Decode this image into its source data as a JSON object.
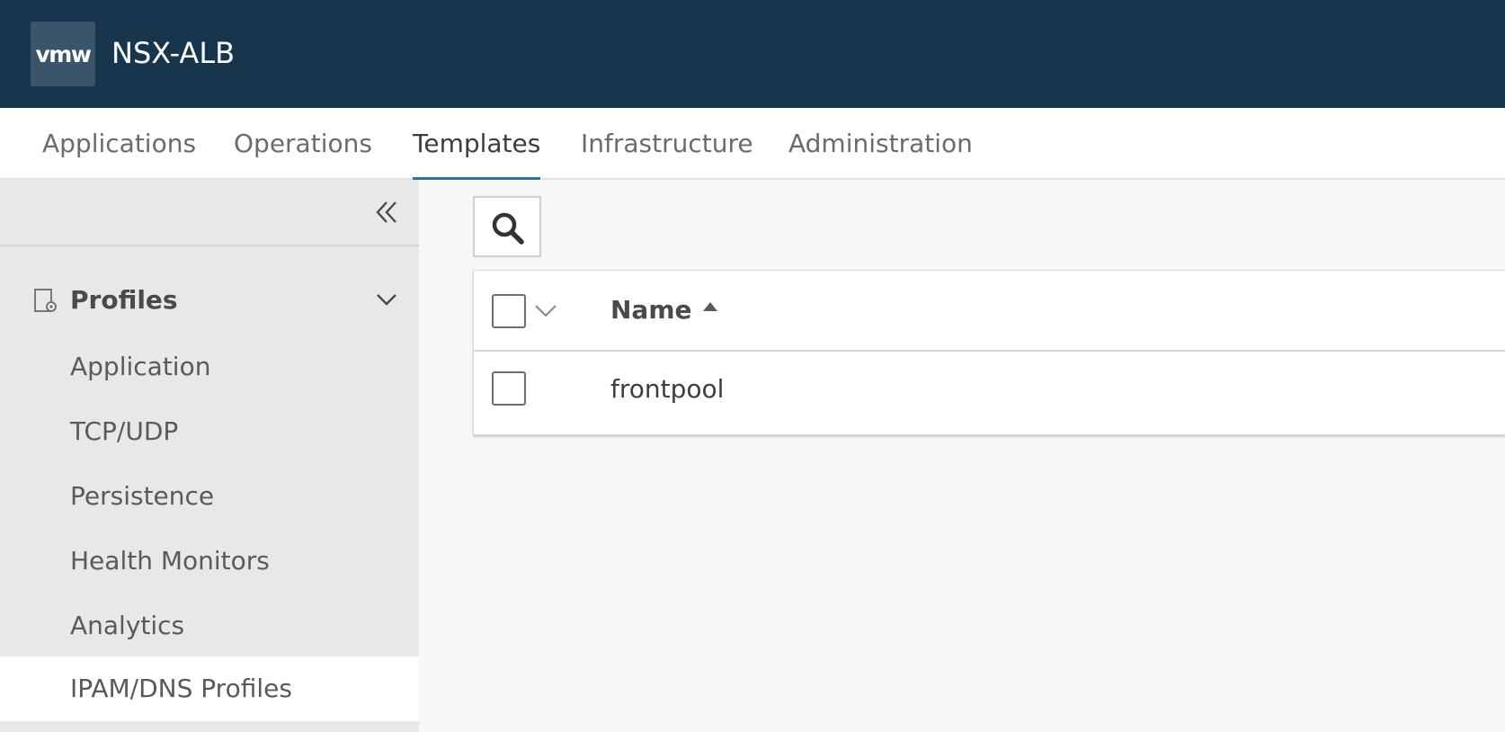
{
  "header": {
    "logo_text": "vmw",
    "app_title": "NSX-ALB"
  },
  "nav": {
    "tabs": [
      {
        "label": "Applications",
        "active": false
      },
      {
        "label": "Operations",
        "active": false
      },
      {
        "label": "Templates",
        "active": true
      },
      {
        "label": "Infrastructure",
        "active": false
      },
      {
        "label": "Administration",
        "active": false
      }
    ]
  },
  "sidebar": {
    "collapse_icon": "double-chevron-left-icon",
    "group": {
      "label": "Profiles",
      "icon": "profile-gear-icon",
      "expanded": true
    },
    "items": [
      {
        "label": "Application",
        "selected": false
      },
      {
        "label": "TCP/UDP",
        "selected": false
      },
      {
        "label": "Persistence",
        "selected": false
      },
      {
        "label": "Health Monitors",
        "selected": false
      },
      {
        "label": "Analytics",
        "selected": false
      },
      {
        "label": "IPAM/DNS Profiles",
        "selected": true
      }
    ]
  },
  "main": {
    "search_icon": "search-icon",
    "grid": {
      "columns": [
        {
          "label": "Name",
          "sort": "ascending"
        }
      ],
      "rows": [
        {
          "name": "frontpool",
          "checked": false
        }
      ]
    }
  },
  "colors": {
    "header_bg": "#17354d",
    "active_tab_underline": "#2b72a8",
    "sidebar_bg": "#e8e8e8",
    "selected_item_bg": "#ffffff"
  }
}
